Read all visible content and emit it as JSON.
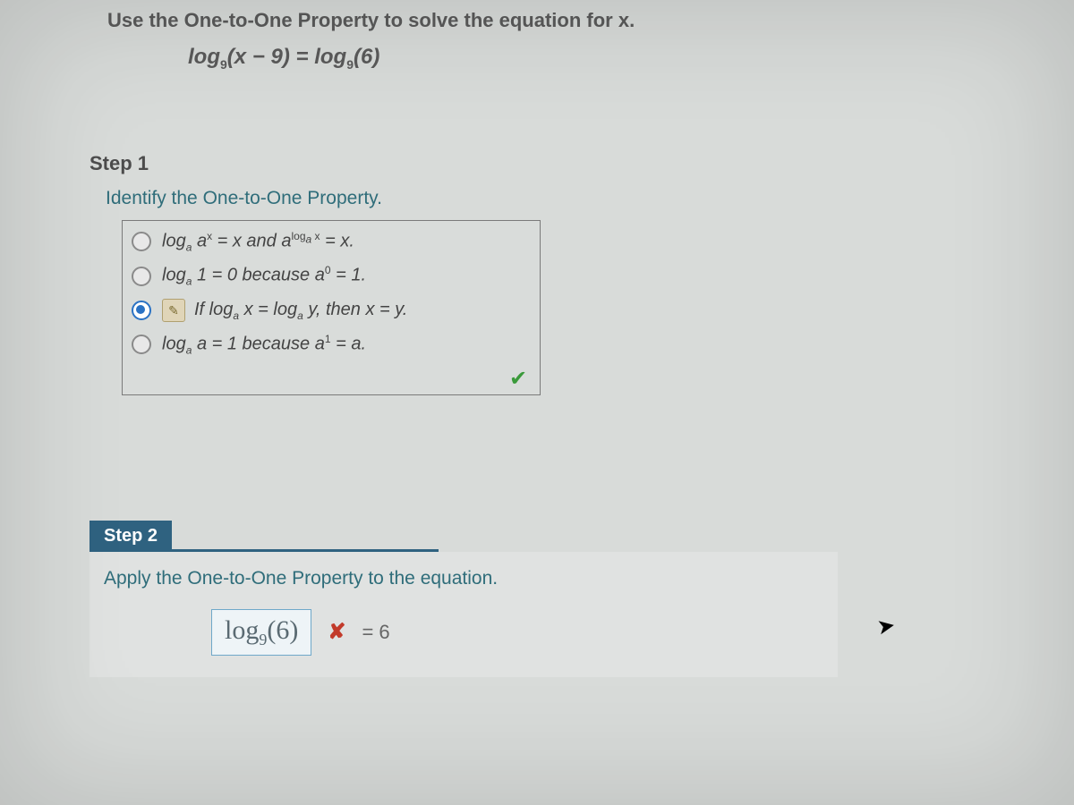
{
  "prompt": {
    "text": "Use the One-to-One Property to solve the equation for x.",
    "equation_html": "log<span class='sub'>9</span>(<span class='var'>x</span> − 9) = log<span class='sub'>9</span>(6)"
  },
  "step1": {
    "heading": "Step 1",
    "subheading": "Identify the One-to-One Property.",
    "options": [
      {
        "html": "log<span class='sub'>a</span> a<span class='sup'>x</span> = x and a<span class='sup'>log<span class='sub'>a</span> x</span> = x.",
        "selected": false,
        "has_hint": false
      },
      {
        "html": "log<span class='sub'>a</span> 1 = 0 because a<span class='sup'>0</span> = 1.",
        "selected": false,
        "has_hint": false
      },
      {
        "html": "If log<span class='sub'>a</span> x = log<span class='sub'>a</span> y, then x = y.",
        "selected": true,
        "has_hint": true
      },
      {
        "html": "log<span class='sub'>a</span> a = 1 because a<span class='sup'>1</span> = a.",
        "selected": false,
        "has_hint": false
      }
    ],
    "correct": true
  },
  "step2": {
    "tab": "Step 2",
    "subheading": "Apply the One-to-One Property to the equation.",
    "answer_html": "log<span class='sub'>9</span>(6)",
    "is_wrong": true,
    "rhs": "= 6"
  },
  "hint_icon_label": "hint"
}
